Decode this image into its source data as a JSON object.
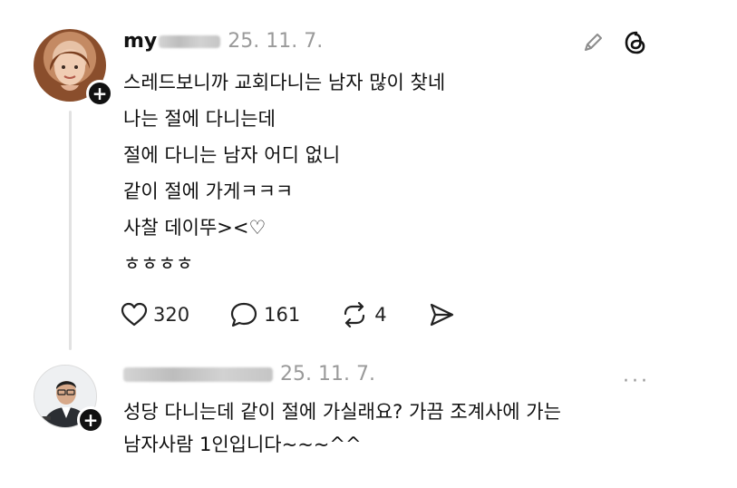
{
  "posts": [
    {
      "author": {
        "handle_visible": "my",
        "date": "25. 11. 7."
      },
      "lines": [
        "스레드보니까 교회다니는 남자 많이 찾네",
        "나는 절에 다니는데",
        "절에 다니는 남자 어디 없니",
        "같이 절에 가게ㅋㅋㅋ",
        "사찰 데이뚜><♡",
        "ㅎㅎㅎㅎ"
      ],
      "actions": {
        "likes": "320",
        "replies": "161",
        "reposts": "4"
      },
      "icons": [
        "pencil-icon",
        "threads-logo-icon",
        "heart-icon",
        "reply-icon",
        "repost-icon",
        "share-icon"
      ]
    },
    {
      "author": {
        "handle_visible": "",
        "date": "25. 11. 7."
      },
      "lines": [
        "성당 다니는데 같이 절에 가실래요? 가끔 조계사에 가는",
        "남자사람 1인입니다~~~^^"
      ],
      "more_label": "···"
    }
  ],
  "badge_symbol": "+"
}
